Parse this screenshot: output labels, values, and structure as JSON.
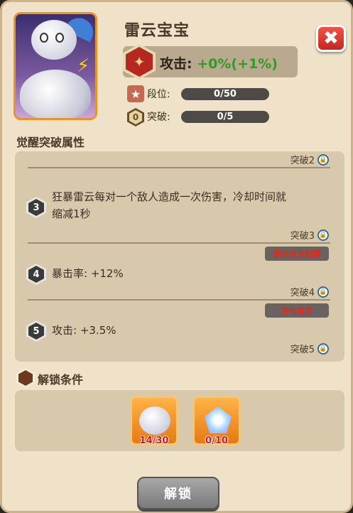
{
  "hero": {
    "name": "雷云宝宝"
  },
  "attack": {
    "label": "攻击:",
    "value": "+0%",
    "bonus": "(+1%)",
    "icon_glyph": "✦"
  },
  "stats": [
    {
      "icon": "star-icon",
      "glyph": "★",
      "label": "段位:",
      "value": "0/50"
    },
    {
      "icon": "breakthrough-icon",
      "glyph": "0",
      "label": "突破:",
      "value": "0/5"
    }
  ],
  "attributes": {
    "title": "觉醒突破属性",
    "tiers": [
      {
        "tag": "突破2"
      },
      {
        "num": "3",
        "text_line1": "狂暴雷云每对一个敌人造成一次伤害，冷却时间就",
        "text_line2": "缩减1秒",
        "tag": "突破3",
        "badge": "雷云宝宝粘稠"
      },
      {
        "num": "4",
        "text": "暴击率: +12%",
        "tag": "突破4",
        "badge": "持有道具"
      },
      {
        "num": "5",
        "text": "攻击: +3.5%",
        "tag": "突破5"
      }
    ]
  },
  "unlock": {
    "title": "解锁条件",
    "items": [
      {
        "icon": "thundercloud-baby-icon",
        "count": "14/30"
      },
      {
        "icon": "crystal-icon",
        "count": "0/10"
      }
    ],
    "button_label": "解锁"
  },
  "colors": {
    "accent": "#e7942c",
    "green": "#2f9b22",
    "red": "#d01818"
  }
}
